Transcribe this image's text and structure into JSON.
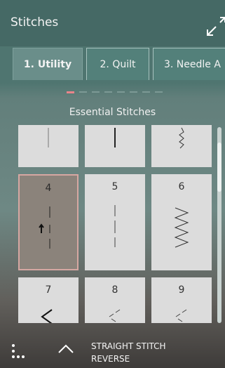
{
  "header": {
    "title": "Stitches"
  },
  "tabs": [
    {
      "label": "1. Utility",
      "active": true
    },
    {
      "label": "2. Quilt",
      "active": false
    },
    {
      "label": "3. Needle A",
      "active": false
    }
  ],
  "page_indicator": {
    "count": 8,
    "active_index": 0
  },
  "category": "Essential Stitches",
  "stitches": [
    {
      "number": "",
      "pattern": "straight-thin",
      "selected": false
    },
    {
      "number": "",
      "pattern": "straight-bold",
      "selected": false
    },
    {
      "number": "",
      "pattern": "zigzag-small",
      "selected": false
    },
    {
      "number": "4",
      "pattern": "straight-reverse",
      "selected": true
    },
    {
      "number": "5",
      "pattern": "straight-dashed",
      "selected": false
    },
    {
      "number": "6",
      "pattern": "zigzag",
      "selected": false
    },
    {
      "number": "7",
      "pattern": "diagonal-bold",
      "selected": false
    },
    {
      "number": "8",
      "pattern": "diagonal-dashed",
      "selected": false
    },
    {
      "number": "9",
      "pattern": "diagonal-dashed",
      "selected": false
    }
  ],
  "footer": {
    "menu_icon": "dots-menu-icon",
    "collapse_icon": "chevron-up-icon",
    "stitch_name_line1": "Straight Stitch",
    "stitch_name_line2": "Reverse"
  },
  "colors": {
    "header_bg": "#456965",
    "tab_active_bg": "#6a8e8a",
    "tile_bg": "#dcdcdc",
    "selected_tile_bg": "#8b837b",
    "selected_border": "#d6a7a2",
    "indicator_active": "#e9848a"
  }
}
